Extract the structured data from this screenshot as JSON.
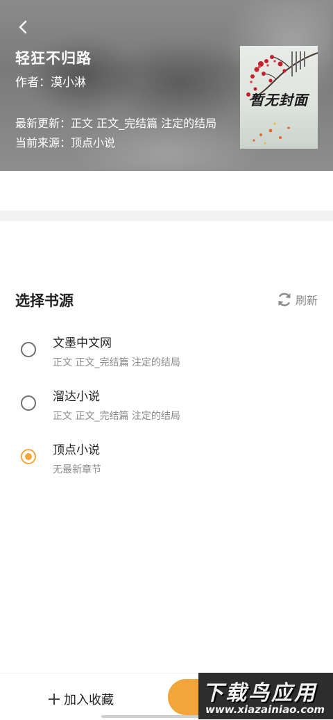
{
  "header": {
    "book_title": "轻狂不归路",
    "author": "作者：漠小淋",
    "latest_update": "最新更新：正文 正文_完结篇 注定的结局",
    "current_source": "当前来源：顶点小说"
  },
  "cover": {
    "text": "暂无封面"
  },
  "source_section": {
    "title": "选择书源",
    "refresh_label": "刷新",
    "accent_color": "#f3a43a",
    "sources": [
      {
        "name": "文墨中文网",
        "chapter": "正文 正文_完结篇 注定的结局",
        "selected": false
      },
      {
        "name": "溜达小说",
        "chapter": "正文 正文_完结篇 注定的结局",
        "selected": false
      },
      {
        "name": "顶点小说",
        "chapter": "无最新章节",
        "selected": true
      }
    ]
  },
  "bottom_bar": {
    "add_favorite_label": "加入收藏",
    "read_button_color": "#f4a53a"
  },
  "watermark": {
    "main": "下载鸟应用",
    "url": "www.xiazainiao.com"
  },
  "icons": {
    "back": "back-arrow-icon",
    "refresh": "refresh-icon",
    "add": "plus-icon"
  }
}
